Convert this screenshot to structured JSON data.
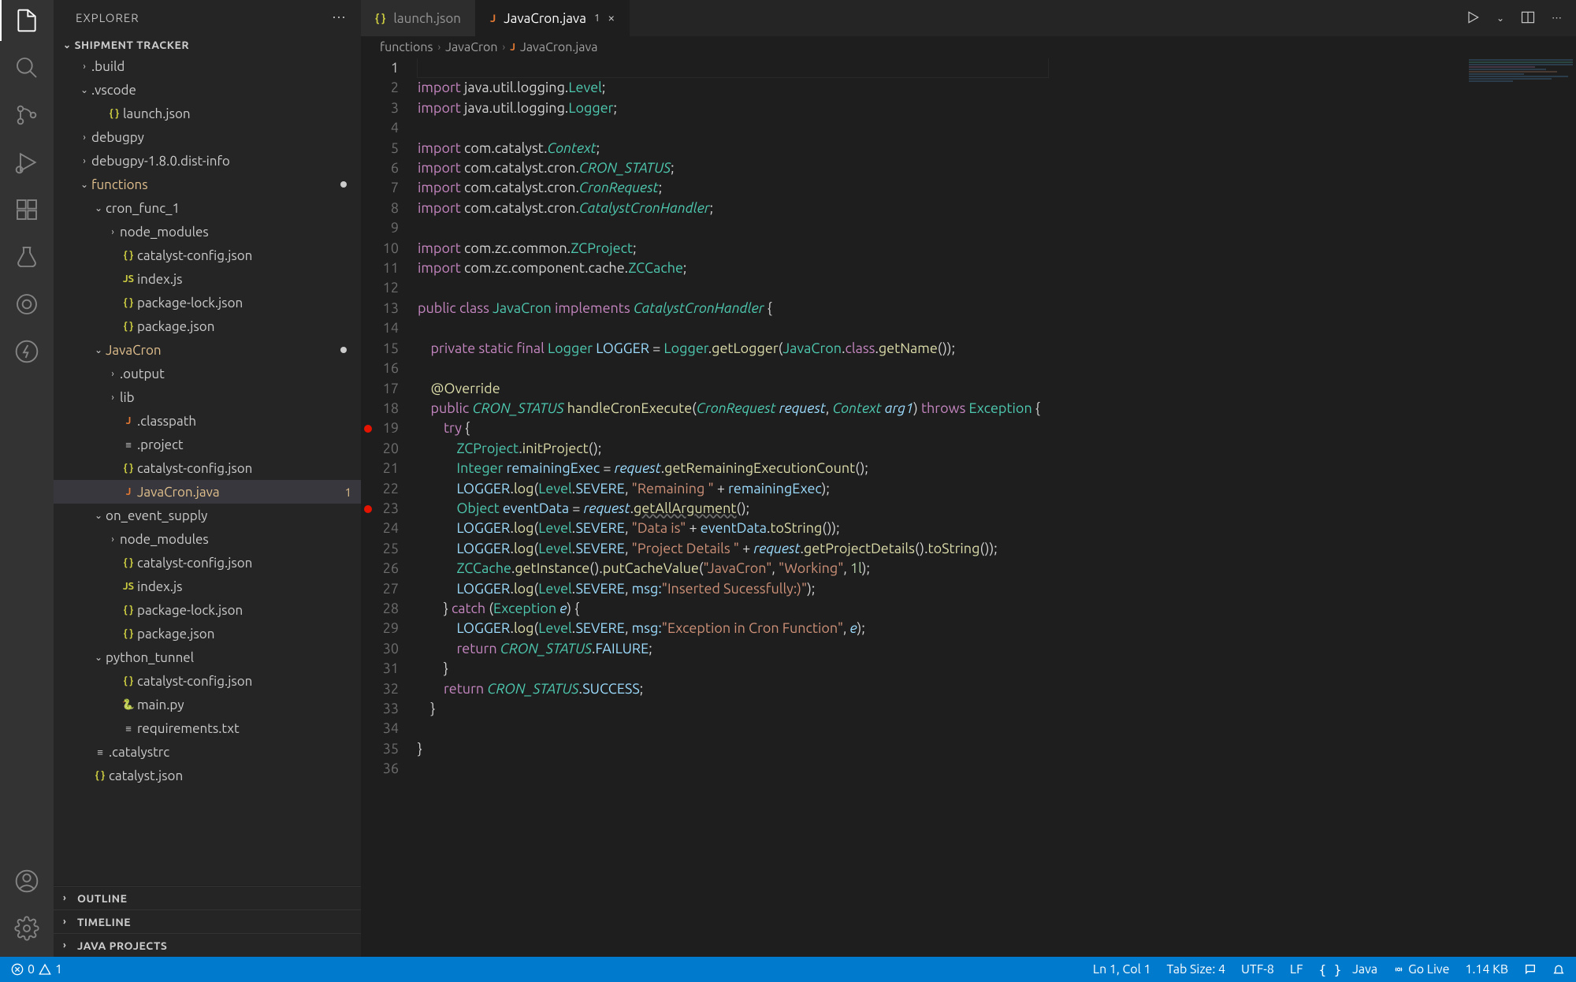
{
  "sidebar": {
    "title": "EXPLORER",
    "project": "SHIPMENT TRACKER",
    "tree": [
      {
        "type": "folder",
        "label": ".build",
        "indent": 1,
        "open": false
      },
      {
        "type": "folder",
        "label": ".vscode",
        "indent": 1,
        "open": true
      },
      {
        "type": "file",
        "label": "launch.json",
        "indent": 2,
        "icon": "json"
      },
      {
        "type": "folder",
        "label": "debugpy",
        "indent": 1,
        "open": false
      },
      {
        "type": "folder",
        "label": "debugpy-1.8.0.dist-info",
        "indent": 1,
        "open": false
      },
      {
        "type": "folder",
        "label": "functions",
        "indent": 1,
        "open": true,
        "mod": true,
        "dot": true
      },
      {
        "type": "folder",
        "label": "cron_func_1",
        "indent": 2,
        "open": true
      },
      {
        "type": "folder",
        "label": "node_modules",
        "indent": 3,
        "open": false
      },
      {
        "type": "file",
        "label": "catalyst-config.json",
        "indent": 3,
        "icon": "json"
      },
      {
        "type": "file",
        "label": "index.js",
        "indent": 3,
        "icon": "js"
      },
      {
        "type": "file",
        "label": "package-lock.json",
        "indent": 3,
        "icon": "json"
      },
      {
        "type": "file",
        "label": "package.json",
        "indent": 3,
        "icon": "json"
      },
      {
        "type": "folder",
        "label": "JavaCron",
        "indent": 2,
        "open": true,
        "mod": true,
        "dot": true
      },
      {
        "type": "folder",
        "label": ".output",
        "indent": 3,
        "open": false
      },
      {
        "type": "folder",
        "label": "lib",
        "indent": 3,
        "open": false
      },
      {
        "type": "file",
        "label": ".classpath",
        "indent": 3,
        "icon": "java"
      },
      {
        "type": "file",
        "label": ".project",
        "indent": 3,
        "icon": "file"
      },
      {
        "type": "file",
        "label": "catalyst-config.json",
        "indent": 3,
        "icon": "json"
      },
      {
        "type": "file",
        "label": "JavaCron.java",
        "indent": 3,
        "icon": "java",
        "mod": true,
        "selected": true,
        "mbadge": "1"
      },
      {
        "type": "folder",
        "label": "on_event_supply",
        "indent": 2,
        "open": true
      },
      {
        "type": "folder",
        "label": "node_modules",
        "indent": 3,
        "open": false
      },
      {
        "type": "file",
        "label": "catalyst-config.json",
        "indent": 3,
        "icon": "json"
      },
      {
        "type": "file",
        "label": "index.js",
        "indent": 3,
        "icon": "js"
      },
      {
        "type": "file",
        "label": "package-lock.json",
        "indent": 3,
        "icon": "json"
      },
      {
        "type": "file",
        "label": "package.json",
        "indent": 3,
        "icon": "json"
      },
      {
        "type": "folder",
        "label": "python_tunnel",
        "indent": 2,
        "open": true
      },
      {
        "type": "file",
        "label": "catalyst-config.json",
        "indent": 3,
        "icon": "json"
      },
      {
        "type": "file",
        "label": "main.py",
        "indent": 3,
        "icon": "py"
      },
      {
        "type": "file",
        "label": "requirements.txt",
        "indent": 3,
        "icon": "file"
      },
      {
        "type": "file",
        "label": ".catalystrc",
        "indent": 1,
        "icon": "file"
      },
      {
        "type": "file",
        "label": "catalyst.json",
        "indent": 1,
        "icon": "json"
      }
    ],
    "bottom": [
      "OUTLINE",
      "TIMELINE",
      "JAVA PROJECTS"
    ]
  },
  "tabs": [
    {
      "label": "launch.json",
      "icon": "json",
      "active": false
    },
    {
      "label": "JavaCron.java",
      "icon": "java",
      "active": true,
      "modified": "1",
      "close": true
    }
  ],
  "breadcrumb": [
    "functions",
    "JavaCron",
    "JavaCron.java"
  ],
  "code": {
    "lines": 36,
    "breakpoints": [
      19,
      23
    ],
    "content": [
      "",
      "<span class='kw'>import</span> java.util.logging.<span class='type'>Level</span>;",
      "<span class='kw'>import</span> java.util.logging.<span class='type'>Logger</span>;",
      "",
      "<span class='kw'>import</span> com.catalyst.<span class='cls'>Context</span>;",
      "<span class='kw'>import</span> com.catalyst.cron.<span class='cls'>CRON_STATUS</span>;",
      "<span class='kw'>import</span> com.catalyst.cron.<span class='cls'>CronRequest</span>;",
      "<span class='kw'>import</span> com.catalyst.cron.<span class='cls'>CatalystCronHandler</span>;",
      "",
      "<span class='kw'>import</span> com.zc.common.<span class='type'>ZCProject</span>;",
      "<span class='kw'>import</span> com.zc.component.cache.<span class='type'>ZCCache</span>;",
      "",
      "<span class='kw'>public</span> <span class='kw'>class</span> <span class='type'>JavaCron</span> <span class='kw'>implements</span> <span class='cls'>CatalystCronHandler</span> {",
      "",
      "    <span class='kw'>private</span> <span class='kw'>static</span> <span class='kw'>final</span> <span class='type'>Logger</span> <span class='var'>LOGGER</span> = <span class='type'>Logger</span>.<span class='fn'>getLogger</span>(<span class='type'>JavaCron</span>.<span class='kw'>class</span>.<span class='fn'>getName</span>());",
      "",
      "    <span class='fn'>@Override</span>",
      "    <span class='kw'>public</span> <span class='cls'>CRON_STATUS</span> <span class='fn'>handleCronExecute</span>(<span class='cls'>CronRequest</span> <span class='param'>request</span>, <span class='cls'>Context</span> <span class='param'>arg1</span>) <span class='kw'>throws</span> <span class='type'>Exception</span> {",
      "        <span class='kw'>try</span> {",
      "            <span class='type'>ZCProject</span>.<span class='fn'>initProject</span>();",
      "            <span class='type'>Integer</span> <span class='var'>remainingExec</span> = <span class='param'>request</span>.<span class='fn'>getRemainingExecutionCount</span>();",
      "            <span class='var'>LOGGER</span>.<span class='fn'>log</span>(<span class='type'>Level</span>.<span class='var'>SEVERE</span>, <span class='str'>\"Remaining \"</span> + <span class='var'>remainingExec</span>);",
      "            <span class='type'>Object</span> <span class='var'>eventData</span> = <span class='param'>request</span>.<span class='fn dead'>getAllArgument</span>();",
      "            <span class='var'>LOGGER</span>.<span class='fn'>log</span>(<span class='type'>Level</span>.<span class='var'>SEVERE</span>, <span class='str'>\"Data is\"</span> + <span class='var'>eventData</span>.<span class='fn'>toString</span>());",
      "            <span class='var'>LOGGER</span>.<span class='fn'>log</span>(<span class='type'>Level</span>.<span class='var'>SEVERE</span>, <span class='str'>\"Project Details \"</span> + <span class='param'>request</span>.<span class='fn'>getProjectDetails</span>().<span class='fn'>toString</span>());",
      "            <span class='type'>ZCCache</span>.<span class='fn'>getInstance</span>().<span class='fn'>putCacheValue</span>(<span class='str'>\"JavaCron\"</span>, <span class='str'>\"Working\"</span>, <span class='num'>1l</span>);",
      "            <span class='var'>LOGGER</span>.<span class='fn'>log</span>(<span class='type'>Level</span>.<span class='var'>SEVERE</span>, <span class='var'>msg:</span><span class='str'>\"Inserted Sucessfully:)\"</span>);",
      "        } <span class='kw'>catch</span> (<span class='type'>Exception</span> <span class='param'>e</span>) {",
      "            <span class='var'>LOGGER</span>.<span class='fn'>log</span>(<span class='type'>Level</span>.<span class='var'>SEVERE</span>, <span class='var'>msg:</span><span class='str'>\"Exception in Cron Function\"</span>, <span class='param'>e</span>);",
      "            <span class='kw'>return</span> <span class='cls'>CRON_STATUS</span>.<span class='var'>FAILURE</span>;",
      "        }",
      "        <span class='kw'>return</span> <span class='cls'>CRON_STATUS</span>.<span class='var'>SUCCESS</span>;",
      "    }",
      "",
      "}",
      ""
    ]
  },
  "status": {
    "errors": "0",
    "warnings": "1",
    "cursor": "Ln 1, Col 1",
    "tabsize": "Tab Size: 4",
    "encoding": "UTF-8",
    "eol": "LF",
    "lang": "Java",
    "golive": "Go Live",
    "size": "1.14 KB"
  }
}
